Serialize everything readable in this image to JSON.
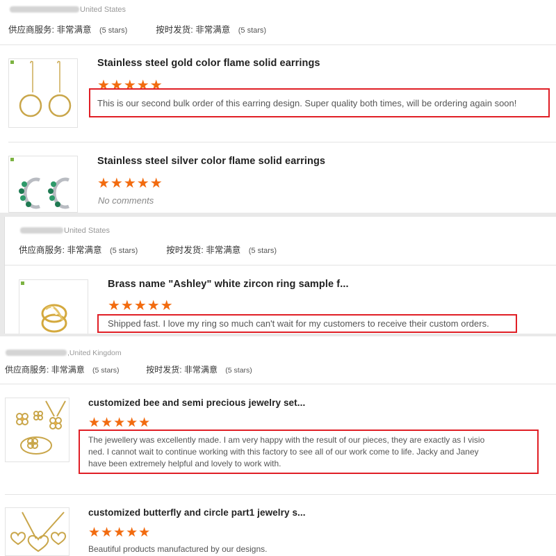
{
  "labels": {
    "service": "供应商服务:",
    "service_value": "非常满意",
    "ship": "按时发货:",
    "ship_value": "非常满意",
    "stars_note": "(5 stars)"
  },
  "colors": {
    "star": "#f26b0f",
    "highlight_border": "#e01e25"
  },
  "reviews": [
    {
      "country": "United States",
      "products": [
        {
          "title": "Stainless steel gold color flame solid earrings",
          "rating": 5,
          "stars": "★★★★★",
          "comment": "This is our second bulk order of this earring design. Super quality both times, will be ordering again soon!"
        },
        {
          "title": "Stainless steel silver color flame solid earrings",
          "rating": 5,
          "stars": "★★★★★",
          "comment": "No comments"
        }
      ]
    },
    {
      "country": "United States",
      "products": [
        {
          "title": "Brass name \"Ashley\" white zircon ring sample f...",
          "rating": 5,
          "stars": "★★★★★",
          "comment": "Shipped fast. I love my ring so much can't wait for my customers to receive their custom orders."
        }
      ]
    },
    {
      "country": ",United Kingdom",
      "products": [
        {
          "title": "customized bee and semi precious jewelry set...",
          "rating": 5,
          "stars": "★★★★★",
          "comment_lines": [
            "The jewellery was excellently made. I am very happy with the result of our pieces, they are exactly as I visio",
            "ned. I cannot wait to continue working with this factory to see all of our work come to life. Jacky and Janey",
            "have been extremely helpful and lovely to work with."
          ]
        },
        {
          "title": "customized butterfly and circle part1 jewelry s...",
          "rating": 5,
          "stars": "★★★★★",
          "comment": "Beautiful products manufactured by our designs."
        }
      ]
    }
  ]
}
